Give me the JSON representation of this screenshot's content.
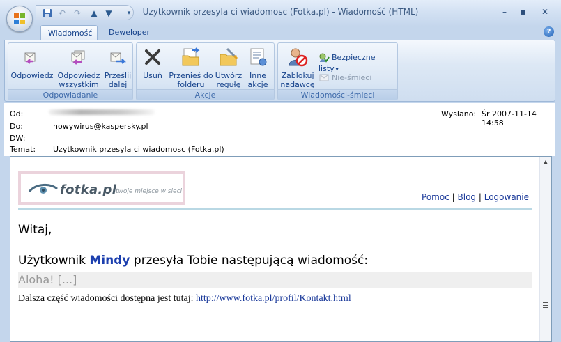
{
  "window": {
    "title": "Uzytkownik przesyla ci wiadomosc (Fotka.pl) - Wiadomość (HTML)",
    "controls": [
      "minimize",
      "maximize",
      "close"
    ]
  },
  "quick_access": [
    "save-icon",
    "undo-icon",
    "redo-icon",
    "up-icon",
    "down-icon",
    "customize-icon"
  ],
  "tabs": [
    {
      "label": "Wiadomość",
      "active": true
    },
    {
      "label": "Deweloper",
      "active": false
    }
  ],
  "ribbon": {
    "groups": [
      {
        "label": "Odpowiadanie",
        "buttons": [
          {
            "label": "Odpowiedz",
            "icon": "reply-icon"
          },
          {
            "label": "Odpowiedz wszystkim",
            "icon": "reply-all-icon"
          },
          {
            "label": "Prześlij dalej",
            "icon": "forward-icon"
          }
        ]
      },
      {
        "label": "Akcje",
        "buttons": [
          {
            "label": "Usuń",
            "icon": "delete-icon"
          },
          {
            "label": "Przenieś do folderu",
            "icon": "move-to-folder-icon"
          },
          {
            "label": "Utwórz regułę",
            "icon": "create-rule-icon"
          },
          {
            "label": "Inne akcje",
            "icon": "other-actions-icon"
          }
        ]
      },
      {
        "label": "Wiadomości-śmieci",
        "buttons": [
          {
            "label": "Zablokuj nadawcę",
            "icon": "block-sender-icon"
          }
        ],
        "small_buttons": [
          {
            "label": "Bezpieczne listy",
            "icon": "safe-lists-icon",
            "enabled": true
          },
          {
            "label": "Nie-śmieci",
            "icon": "not-junk-icon",
            "enabled": false
          }
        ]
      }
    ]
  },
  "header": {
    "from_label": "Od:",
    "to_label": "Do:",
    "to_value": "nowywirus@kaspersky.pl",
    "cc_label": "DW:",
    "subject_label": "Temat:",
    "subject_value": "Uzytkownik przesyla ci wiadomosc (Fotka.pl)",
    "sent_label": "Wysłano:",
    "sent_value": "Śr 2007-11-14 14:58"
  },
  "body": {
    "logo_text": "fotka.pl",
    "logo_tagline": "twoje miejsce w sieci",
    "nav": [
      "Pomoc",
      "Blog",
      "Logowanie"
    ],
    "nav_separator": "|",
    "greeting": "Witaj,",
    "line_prefix": "Użytkownik",
    "user_name": "Mindy",
    "line_suffix": "przesyła Tobie następującą wiadomość:",
    "quote": "Aloha! [...]",
    "more_text": "Dalsza część wiadomości dostępna jest tutaj:",
    "more_link": "http://www.fotka.pl/profil/Kontakt.html"
  }
}
